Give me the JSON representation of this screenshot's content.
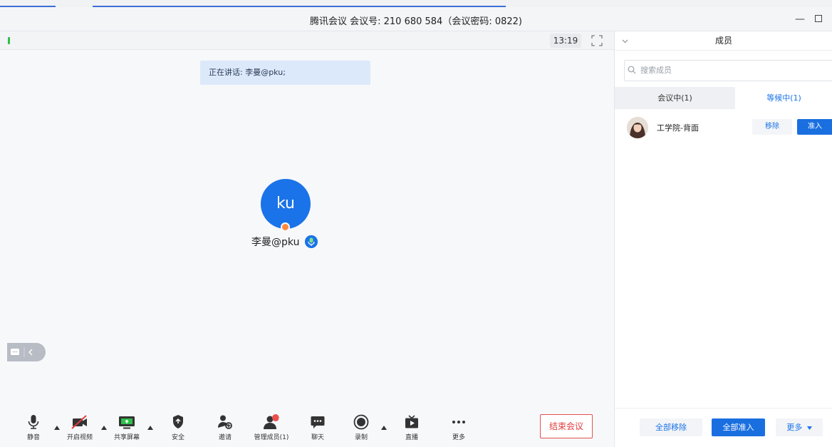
{
  "window": {
    "title": "腾讯会议 会议号: 210 680 584（会议密码: 0822)"
  },
  "meeting": {
    "timer": "13:19",
    "speaking": "正在讲话: 李曼@pku;",
    "avatar_initials": "ku",
    "participant_name": "李曼@pku"
  },
  "toolbar": {
    "mute": "静音",
    "video": "开启视频",
    "share": "共享屏幕",
    "security": "安全",
    "invite": "邀请",
    "manage": "管理成员(1)",
    "manage_badge": "1",
    "chat": "聊天",
    "record": "录制",
    "live": "直播",
    "more": "更多",
    "end": "结束会议"
  },
  "panel": {
    "title": "成员",
    "search_placeholder": "搜索成员",
    "tab_in_meeting": "会议中(1)",
    "tab_waiting": "等候中(1)",
    "waiting_member": {
      "name": "工学院-背面",
      "remove": "移除",
      "admit": "准入"
    },
    "footer": {
      "remove_all": "全部移除",
      "admit_all": "全部准入",
      "more": "更多"
    }
  },
  "colors": {
    "accent": "#1a73e8",
    "end_red": "#e03c3c",
    "talk_green": "#2fbf4b"
  }
}
